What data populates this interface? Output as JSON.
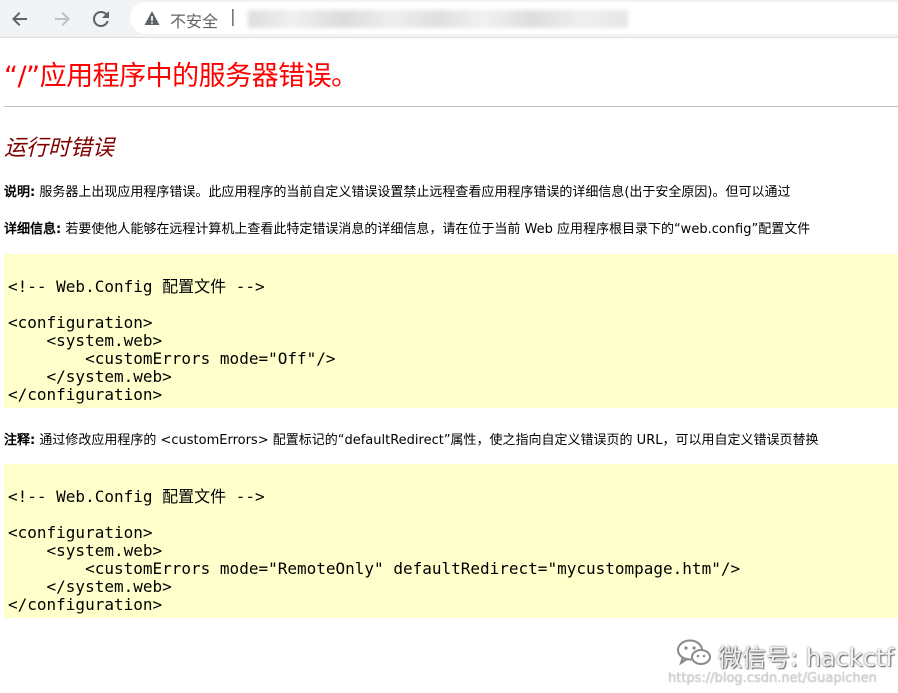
{
  "browser": {
    "insecure_label": "不安全",
    "url_separator": "|"
  },
  "page": {
    "title": "“/”应用程序中的服务器错误。",
    "subtitle": "运行时错误",
    "description": {
      "label": "说明:",
      "text": "服务器上出现应用程序错误。此应用程序的当前自定义错误设置禁止远程查看应用程序错误的详细信息(出于安全原因)。但可以通过"
    },
    "details": {
      "label": "详细信息:",
      "text": "若要使他人能够在远程计算机上查看此特定错误消息的详细信息，请在位于当前 Web 应用程序根目录下的“web.config”配置文件"
    },
    "code1": [
      "",
      "<!-- Web.Config 配置文件 -->",
      "",
      "<configuration>",
      "    <system.web>",
      "        <customErrors mode=\"Off\"/>",
      "    </system.web>",
      "</configuration>"
    ],
    "note": {
      "label": "注释:",
      "text": "通过修改应用程序的 <customErrors> 配置标记的“defaultRedirect”属性，使之指向自定义错误页的 URL，可以用自定义错误页替换"
    },
    "code2": [
      "",
      "<!-- Web.Config 配置文件 -->",
      "",
      "<configuration>",
      "    <system.web>",
      "        <customErrors mode=\"RemoteOnly\" defaultRedirect=\"mycustompage.htm\"/>",
      "    </system.web>",
      "</configuration>"
    ]
  },
  "watermark": {
    "wechat": "微信号: hackctf",
    "csdn": "https://blog.csdn.net/Guapichen"
  },
  "colors": {
    "title": "#ff0000",
    "subtitle": "#800000",
    "code_bg": "#ffffcc"
  }
}
